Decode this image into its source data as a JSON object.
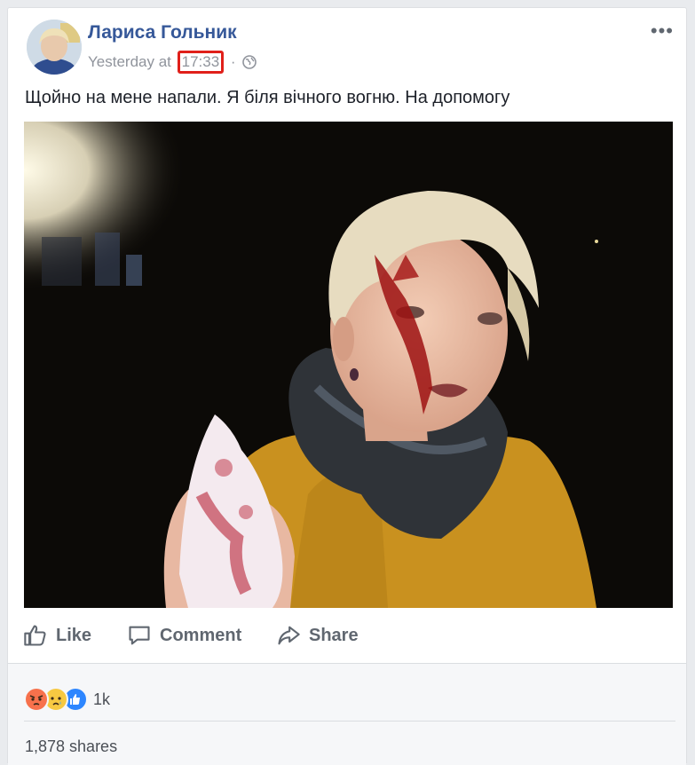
{
  "post": {
    "author_name": "Лариса Гольник",
    "timestamp_prefix": "Yesterday at",
    "timestamp_time": "17:33",
    "separator": "·",
    "privacy_icon": "globe-icon",
    "more_icon": "ellipsis-icon",
    "text": "Щойно на мене напали. Я біля вічного вогню. На допомогу"
  },
  "actions": {
    "like_label": "Like",
    "comment_label": "Comment",
    "share_label": "Share"
  },
  "reactions": {
    "icons": [
      "angry-reaction-icon",
      "sad-reaction-icon",
      "like-reaction-icon"
    ],
    "count": "1k"
  },
  "shares_text": "1,878 shares",
  "colors": {
    "link_blue": "#365899",
    "highlight_red": "#e0201a",
    "secondary_text": "#90949c",
    "action_gray": "#606770"
  }
}
